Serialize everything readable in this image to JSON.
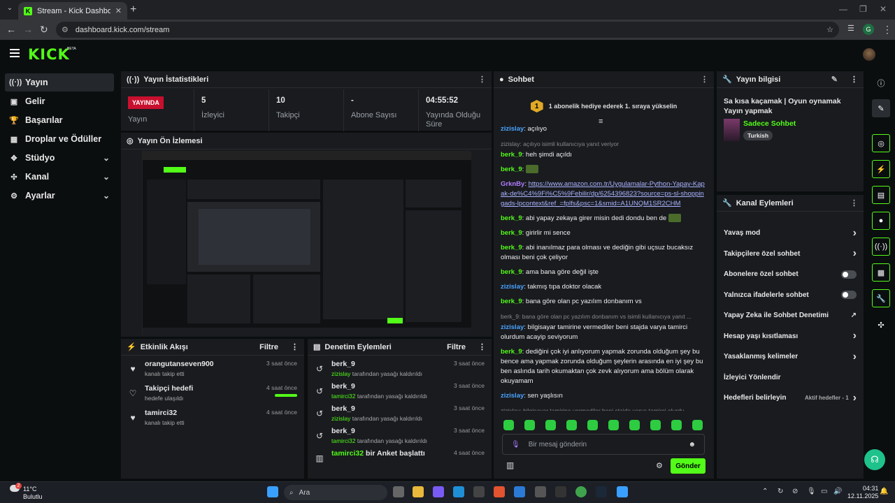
{
  "browser": {
    "tab_title": "Stream - Kick Dashboard",
    "url": "dashboard.kick.com/stream",
    "profile": "G"
  },
  "brand": {
    "logo": "KICK",
    "beta": "BETA",
    "accent": "#53fc18"
  },
  "nav": [
    {
      "label": "Yayın",
      "icon": "broadcast-icon"
    },
    {
      "label": "Gelir",
      "icon": "wallet-icon"
    },
    {
      "label": "Başarılar",
      "icon": "trophy-icon"
    },
    {
      "label": "Droplar ve Ödüller",
      "icon": "gift-icon"
    },
    {
      "label": "Stüdyo",
      "icon": "studio-icon"
    },
    {
      "label": "Kanal",
      "icon": "channel-icon"
    },
    {
      "label": "Ayarlar",
      "icon": "gear-icon"
    }
  ],
  "stats": {
    "title": "Yayın İstatistikleri",
    "live_badge": "YAYINDA",
    "live_label": "Yayın",
    "viewers": "5",
    "viewers_label": "İzleyici",
    "followers": "10",
    "followers_label": "Takipçi",
    "subs": "-",
    "subs_label": "Abone Sayısı",
    "uptime": "04:55:52",
    "uptime_label": "Yayında Olduğu Süre"
  },
  "preview": {
    "title": "Yayın Ön İzlemesi"
  },
  "activity": {
    "title": "Etkinlik Akışı",
    "filter": "Filtre",
    "items": [
      {
        "name": "orangutanseven900",
        "sub": "kanalı takip etti",
        "time": "3 saat önce"
      },
      {
        "name": "Takipçi hedefi",
        "sub": "hedefe ulaşıldı",
        "time": "4 saat önce"
      },
      {
        "name": "tamirci32",
        "sub": "kanalı takip etti",
        "time": "4 saat önce"
      }
    ]
  },
  "moderation": {
    "title": "Denetim Eylemleri",
    "filter": "Filtre",
    "items": [
      {
        "name": "berk_9",
        "by": "zizislay",
        "sub": "tarafından yasağı kaldırıldı",
        "time": "3 saat önce"
      },
      {
        "name": "berk_9",
        "by": "tamirci32",
        "sub": "tarafından yasağı kaldırıldı",
        "time": "3 saat önce"
      },
      {
        "name": "berk_9",
        "by": "zizislay",
        "sub": "tarafından yasağı kaldırıldı",
        "time": "3 saat önce"
      },
      {
        "name": "berk_9",
        "by": "tamirci32",
        "sub": "tarafından yasağı kaldırıldı",
        "time": "3 saat önce"
      },
      {
        "name": "tamirci32",
        "by": "",
        "sub": "bir Anket başlattı",
        "time": "4 saat önce"
      }
    ]
  },
  "chat": {
    "title": "Sohbet",
    "sub_rank": "1",
    "sub_text": "1 abonelik hediye ederek 1. sıraya yükselin",
    "placeholder": "Bir mesaj gönderin",
    "send": "Gönder",
    "messages": [
      {
        "user": "zizislay",
        "color": "b",
        "text": ": açılıyo"
      },
      {
        "reply": "zizislay: açılıyo isimli kullanıcıya yanıt veriyor",
        "user": "berk_9",
        "color": "g",
        "text": ": heh şimdi açıldı"
      },
      {
        "user": "berk_9",
        "color": "g",
        "text": ":",
        "emote": true
      },
      {
        "user": "GrknBy",
        "color": "p",
        "text": ":",
        "link": "https://www.amazon.com.tr/Uygulamalar-Python-Yapay-Kapak-de%C4%9Fi%C5%9Febilir/dp/6254396823?source=ps-sl-shoppingads-lpcontext&ref_=fplfs&psc=1&smid=A1UNQM1SR2CHM"
      },
      {
        "user": "berk_9",
        "color": "g",
        "text": ": abi yapay zekaya girer misin dedi dondu ben de",
        "emote": true
      },
      {
        "user": "berk_9",
        "color": "g",
        "text": ": girirlir mi sence"
      },
      {
        "user": "berk_9",
        "color": "g",
        "text": ": abi inanılmaz para olması ve dediğin gibi uçsuz bucaksız olması beni çok çeliyor"
      },
      {
        "user": "berk_9",
        "color": "g",
        "text": ": ama bana göre değil işte"
      },
      {
        "user": "zizislay",
        "color": "b",
        "text": ": takmış tıpa doktor olacak"
      },
      {
        "user": "berk_9",
        "color": "g",
        "text": ": bana göre olan pc yazılım donbanım vs"
      },
      {
        "reply": "berk_9: bana göre olan pc yazılım donbanım vs isimli kullanıcıya yanıt ...",
        "user": "zizislay",
        "color": "b",
        "text": ": bilgisayar tamirine vermediler beni stajda varya tamirci olurdum acayip seviyorum"
      },
      {
        "user": "berk_9",
        "color": "g",
        "text": ": dediğini çok iyi anlıyorum yapmak zorunda olduğum şey bu bence ama yapmak zorunda olduğum şeylerin arasında en iyi şey bu ben aslında tarih okumaktan çok zevk alıyorum ama bölüm olarak okuyamam"
      },
      {
        "user": "zizislay",
        "color": "b",
        "text": ": sen yaşlısın"
      },
      {
        "reply": "zizislay: bilgisayar tamirine vermediler beni stajda varya tamirci olurdu...",
        "user": "berk_9",
        "color": "g",
        "text": ":",
        "emote": true
      }
    ]
  },
  "info": {
    "title": "Yayın bilgisi",
    "stream_title": "Sa kısa kaçamak | Oyun oynamak Yayın yapmak",
    "category": "Sadece Sohbet",
    "tag": "Turkish"
  },
  "actions": {
    "title": "Kanal Eylemleri",
    "items": [
      {
        "label": "Yavaş mod",
        "ctl": "chev"
      },
      {
        "label": "Takipçilere özel sohbet",
        "ctl": "chev"
      },
      {
        "label": "Abonelere özel sohbet",
        "ctl": "toggle"
      },
      {
        "label": "Yalnızca ifadelerle sohbet",
        "ctl": "toggle"
      },
      {
        "label": "Yapay Zeka ile Sohbet Denetimi",
        "ctl": "ext"
      },
      {
        "label": "Hesap yaşı kısıtlaması",
        "ctl": "chev"
      },
      {
        "label": "Yasaklanmış kelimeler",
        "ctl": "chev"
      },
      {
        "label": "İzleyici Yönlendir",
        "ctl": "none"
      },
      {
        "label": "Hedefleri belirleyin",
        "ctl": "chev",
        "extra": "Aktif hedefler - 1"
      }
    ]
  },
  "taskbar": {
    "temp": "11°C",
    "weather": "Bulutlu",
    "search": "Ara",
    "time": "04:31",
    "date": "12.11.2025",
    "notif": "2"
  }
}
